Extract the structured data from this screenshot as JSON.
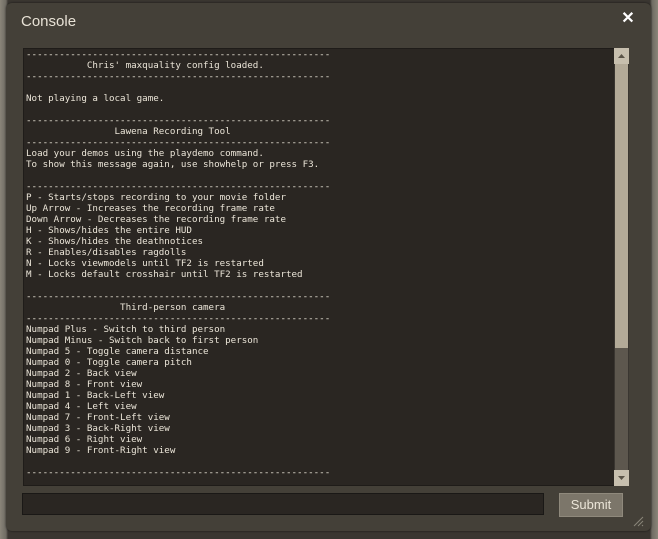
{
  "window": {
    "title": "Console",
    "close_glyph": "✕"
  },
  "log_lines": [
    "-------------------------------------------------------",
    "           Chris' maxquality config loaded.",
    "-------------------------------------------------------",
    "",
    "Not playing a local game.",
    "",
    "-------------------------------------------------------",
    "                Lawena Recording Tool",
    "-------------------------------------------------------",
    "Load your demos using the playdemo command.",
    "To show this message again, use showhelp or press F3.",
    "",
    "-------------------------------------------------------",
    "P - Starts/stops recording to your movie folder",
    "Up Arrow - Increases the recording frame rate",
    "Down Arrow - Decreases the recording frame rate",
    "H - Shows/hides the entire HUD",
    "K - Shows/hides the deathnotices",
    "R - Enables/disables ragdolls",
    "N - Locks viewmodels until TF2 is restarted",
    "M - Locks default crosshair until TF2 is restarted",
    "",
    "-------------------------------------------------------",
    "                 Third-person camera",
    "-------------------------------------------------------",
    "Numpad Plus - Switch to third person",
    "Numpad Minus - Switch back to first person",
    "Numpad 5 - Toggle camera distance",
    "Numpad 0 - Toggle camera pitch",
    "Numpad 2 - Back view",
    "Numpad 8 - Front view",
    "Numpad 1 - Back-Left view",
    "Numpad 4 - Left view",
    "Numpad 7 - Front-Left view",
    "Numpad 3 - Back-Right view",
    "Numpad 6 - Right view",
    "Numpad 9 - Front-Right view",
    "",
    "-------------------------------------------------------"
  ],
  "command": {
    "value": "",
    "placeholder": ""
  },
  "submit_label": "Submit",
  "icons": {
    "close": "close-icon",
    "scroll_up": "up-arrow-icon",
    "scroll_down": "down-arrow-icon",
    "resize": "resize-grip-icon"
  },
  "colors": {
    "window_bg": "#444038",
    "log_bg": "#2a2622",
    "text": "#ebe5d8",
    "scroll_thumb": "#b3aa98",
    "button_bg": "#7c766a"
  }
}
